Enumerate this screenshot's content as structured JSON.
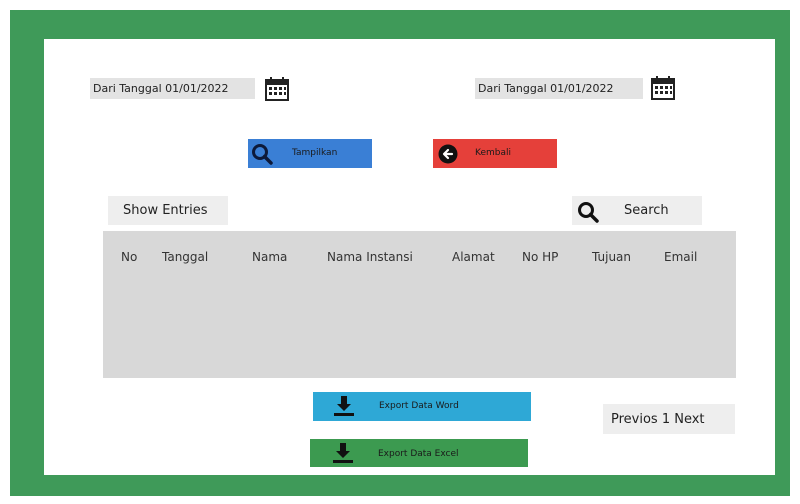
{
  "filter": {
    "date_from_label": "Dari Tanggal 01/01/2022",
    "date_to_label": "Dari Tanggal 01/01/2022"
  },
  "buttons": {
    "show_label": "Tampilkan",
    "back_label": "Kembali",
    "export_word_label": "Export Data Word",
    "export_excel_label": "Export Data Excel"
  },
  "table": {
    "show_entries_label": "Show Entries",
    "search_label": "Search",
    "columns": [
      "No",
      "Tanggal",
      "Nama",
      "Nama Instansi",
      "Alamat",
      "No HP",
      "Tujuan",
      "Email"
    ]
  },
  "pagination": {
    "label": "Previos 1 Next"
  },
  "colors": {
    "frame": "#3f9a59",
    "show_button": "#3a7fd5",
    "back_button": "#e5403a",
    "export_word": "#2ea8d6",
    "export_excel": "#3c9a50",
    "table_bg": "#d8d8d8"
  },
  "icons": {
    "date_from": "calendar-icon",
    "date_to": "calendar-icon",
    "show_button": "search-icon",
    "back_button": "arrow-left-circle-icon",
    "search": "search-icon",
    "export_word": "download-icon",
    "export_excel": "download-icon"
  }
}
